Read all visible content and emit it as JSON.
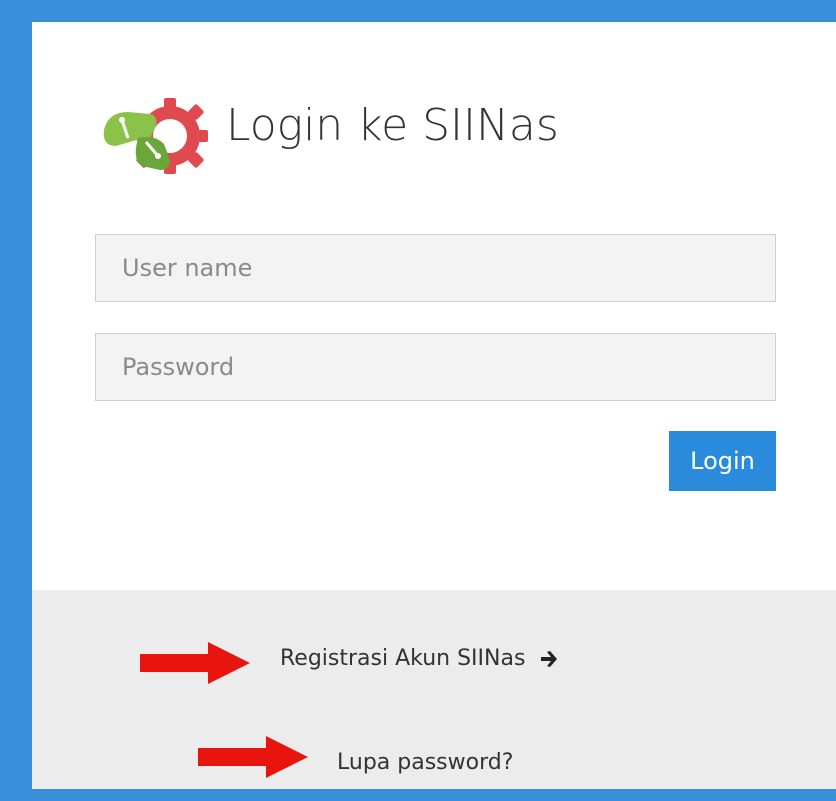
{
  "header": {
    "title": "Login ke SIINas",
    "logo_icon": "gear-logo-icon"
  },
  "form": {
    "username_placeholder": "User name",
    "password_placeholder": "Password",
    "login_label": "Login"
  },
  "footer": {
    "register_label": "Registrasi Akun SIINas",
    "register_icon": "arrow-right-icon",
    "forgot_label": "Lupa password?"
  },
  "annotations": {
    "arrow_color": "#e8140e",
    "icon": "red-arrow-icon"
  },
  "colors": {
    "frame": "#3a8fdd",
    "button": "#2a8bdc",
    "footer": "#ececec",
    "input_bg": "#f3f3f3"
  }
}
